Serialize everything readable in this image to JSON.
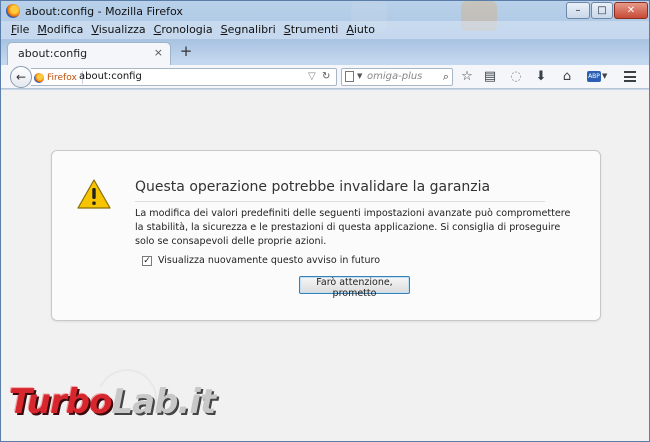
{
  "window": {
    "title": "about:config - Mozilla Firefox",
    "controls": {
      "minimize": "–",
      "maximize": "□",
      "close": "✕"
    }
  },
  "menubar": {
    "items": [
      {
        "label": "File"
      },
      {
        "label": "Modifica"
      },
      {
        "label": "Visualizza"
      },
      {
        "label": "Cronologia"
      },
      {
        "label": "Segnalibri"
      },
      {
        "label": "Strumenti"
      },
      {
        "label": "Aiuto"
      }
    ]
  },
  "tabs": [
    {
      "label": "about:config",
      "close": "×"
    }
  ],
  "new_tab": "+",
  "navbar": {
    "back": "←",
    "identity_label": "Firefox",
    "url": "about:config",
    "url_dropdown": "▽",
    "reload": "↻",
    "search_placeholder": "omiga-plus",
    "search_go": "⌕",
    "toolbar_icons": [
      "bookmark-star-icon",
      "reading-list-icon",
      "zoom-icon",
      "download-icon",
      "home-icon"
    ],
    "addon_label": "ABP"
  },
  "warning": {
    "title": "Questa operazione potrebbe invalidare la garanzia",
    "message": "La modifica dei valori predefiniti delle seguenti impostazioni avanzate può compromettere la stabilità, la sicurezza e le prestazioni di questa applicazione. Si consiglia di proseguire solo se consapevoli delle proprie azioni.",
    "checkbox_label": "Visualizza nuovamente questo avviso in futuro",
    "checkbox_checked": true,
    "checkbox_mark": "✓",
    "button_label": "Farò attenzione, prometto"
  },
  "watermark": {
    "part1": "Turbo",
    "part2": "Lab.it"
  },
  "colors": {
    "accent": "#3c7fb1",
    "warning": "#f6c400",
    "watermark": "#d7262d"
  }
}
